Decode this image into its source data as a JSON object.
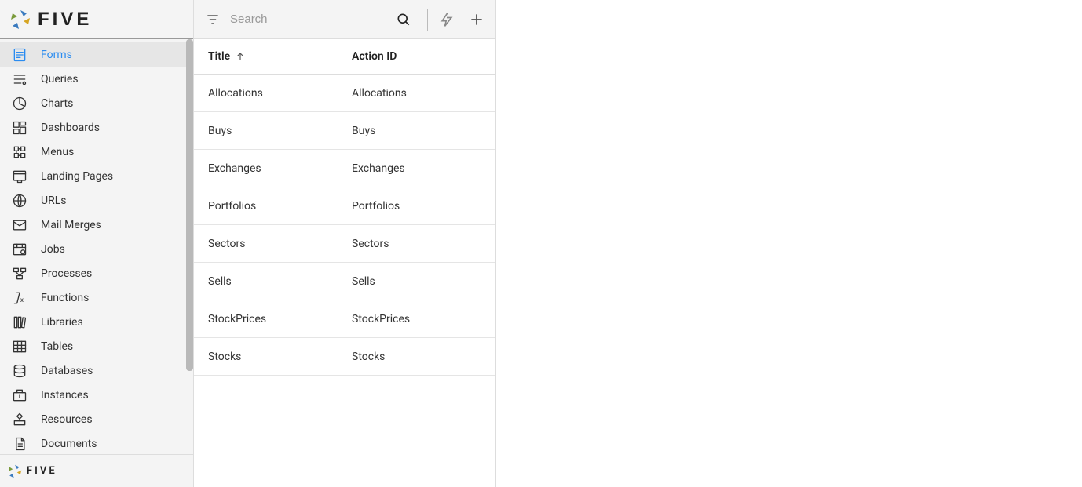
{
  "brand_text": "FIVE",
  "footer_brand_text": "FIVE",
  "sidebar": {
    "items": [
      {
        "label": "Forms",
        "selected": true,
        "icon": "form"
      },
      {
        "label": "Queries",
        "selected": false,
        "icon": "query"
      },
      {
        "label": "Charts",
        "selected": false,
        "icon": "chart"
      },
      {
        "label": "Dashboards",
        "selected": false,
        "icon": "dashboard"
      },
      {
        "label": "Menus",
        "selected": false,
        "icon": "menu"
      },
      {
        "label": "Landing Pages",
        "selected": false,
        "icon": "landing"
      },
      {
        "label": "URLs",
        "selected": false,
        "icon": "url"
      },
      {
        "label": "Mail Merges",
        "selected": false,
        "icon": "mail"
      },
      {
        "label": "Jobs",
        "selected": false,
        "icon": "jobs"
      },
      {
        "label": "Processes",
        "selected": false,
        "icon": "process"
      },
      {
        "label": "Functions",
        "selected": false,
        "icon": "function"
      },
      {
        "label": "Libraries",
        "selected": false,
        "icon": "library"
      },
      {
        "label": "Tables",
        "selected": false,
        "icon": "table"
      },
      {
        "label": "Databases",
        "selected": false,
        "icon": "database"
      },
      {
        "label": "Instances",
        "selected": false,
        "icon": "instance"
      },
      {
        "label": "Resources",
        "selected": false,
        "icon": "resource"
      },
      {
        "label": "Documents",
        "selected": false,
        "icon": "document"
      }
    ]
  },
  "toolbar": {
    "search_placeholder": "Search"
  },
  "table": {
    "columns": [
      {
        "label": "Title",
        "sort": "asc"
      },
      {
        "label": "Action ID"
      }
    ],
    "rows": [
      {
        "title": "Allocations",
        "action_id": "Allocations"
      },
      {
        "title": "Buys",
        "action_id": "Buys"
      },
      {
        "title": "Exchanges",
        "action_id": "Exchanges"
      },
      {
        "title": "Portfolios",
        "action_id": "Portfolios"
      },
      {
        "title": "Sectors",
        "action_id": "Sectors"
      },
      {
        "title": "Sells",
        "action_id": "Sells"
      },
      {
        "title": "StockPrices",
        "action_id": "StockPrices"
      },
      {
        "title": "Stocks",
        "action_id": "Stocks"
      }
    ]
  }
}
